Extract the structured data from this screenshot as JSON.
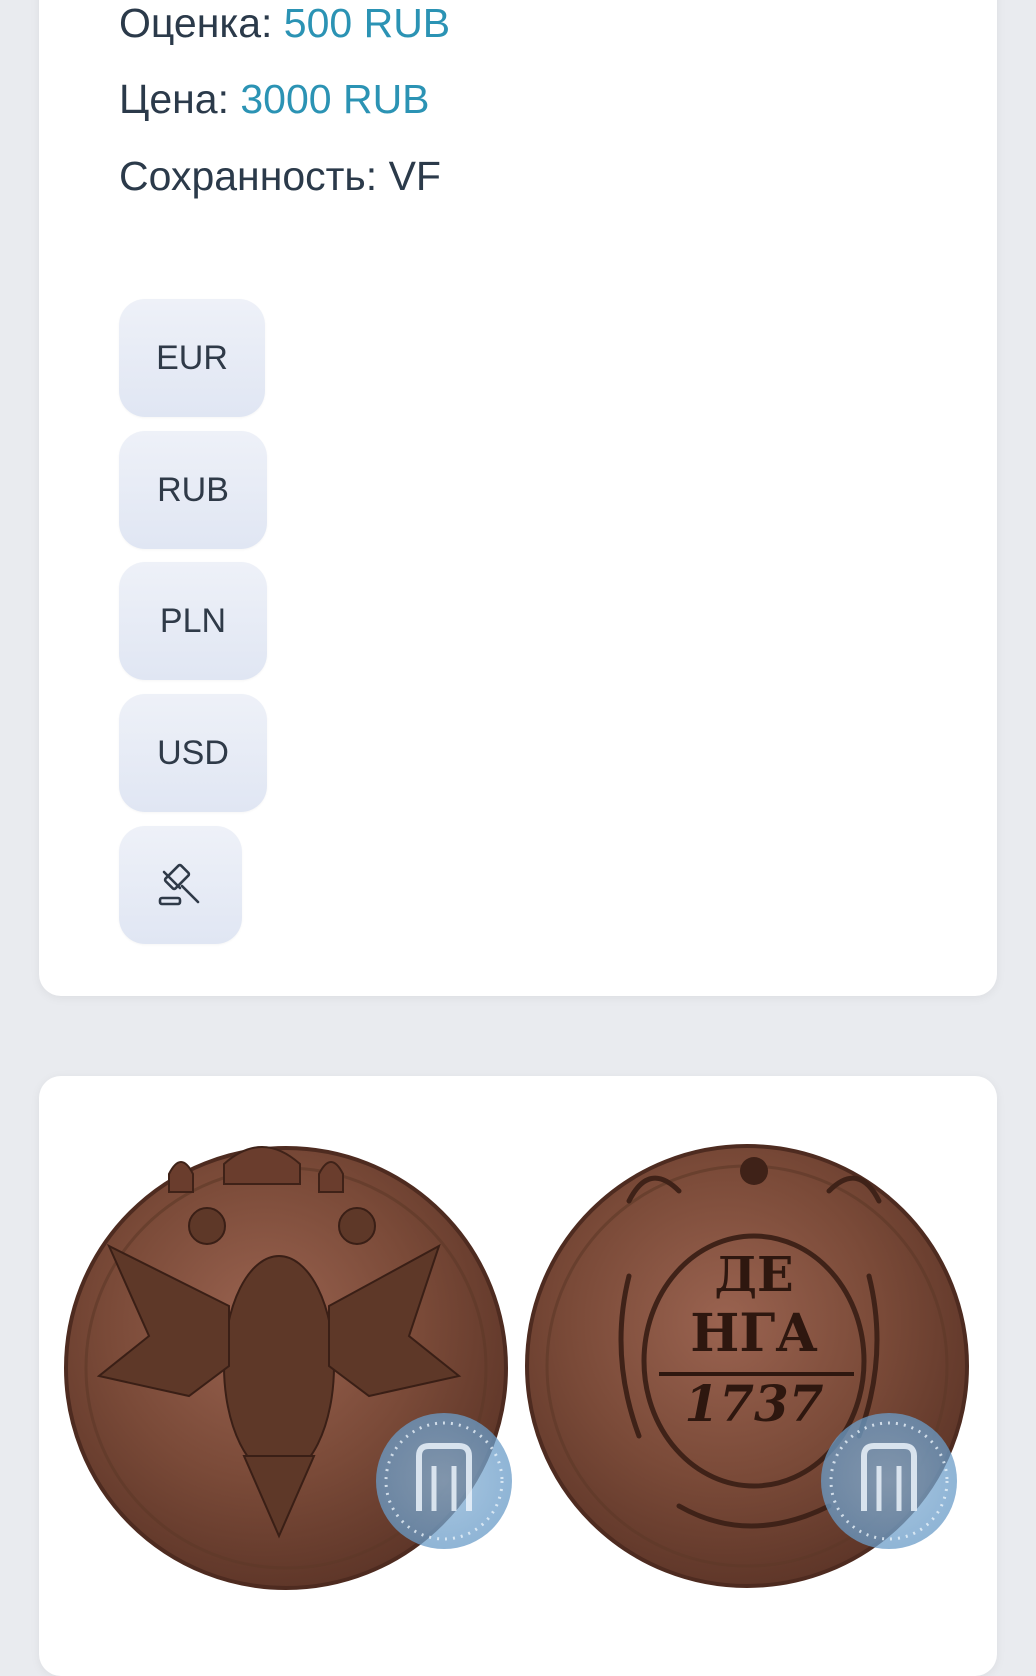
{
  "lot": {
    "estimate_label": "Оценка: ",
    "estimate_value": "500 RUB",
    "price_label": "Цена: ",
    "price_value": "3000 RUB",
    "condition_label": "Сохранность: ",
    "condition_value": "VF"
  },
  "currencies": [
    "EUR",
    "RUB",
    "PLN",
    "USD"
  ],
  "auction_icon": "gavel-icon",
  "coin": {
    "reverse_text": [
      "ДЕ",
      "НГА",
      "1737"
    ],
    "watermark_icon": "auction-logo-watermark"
  },
  "colors": {
    "accent": "#2b93b4",
    "text": "#2b3a4a",
    "background": "#e9ebef",
    "button_bg": "#e6ebf5",
    "copper": "#7a4a38"
  }
}
